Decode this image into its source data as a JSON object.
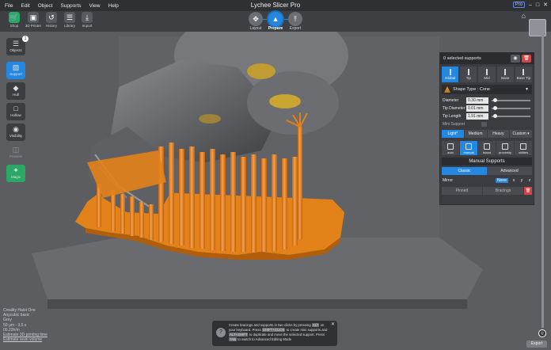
{
  "menu": [
    "File",
    "Edit",
    "Object",
    "Supports",
    "View",
    "Help"
  ],
  "app_title": "Lychee Slicer Pro",
  "pro_badge": "Pro",
  "toolbar": {
    "tools": [
      {
        "label": "Shop",
        "icon": "cart-icon"
      },
      {
        "label": "3D Printer",
        "icon": "printer-icon"
      },
      {
        "label": "History",
        "icon": "history-icon"
      },
      {
        "label": "Library",
        "icon": "library-icon"
      },
      {
        "label": "Import",
        "icon": "import-icon"
      }
    ],
    "modes": [
      {
        "label": "Layout",
        "icon": "move-icon"
      },
      {
        "label": "Prepare",
        "icon": "support-icon",
        "active": true
      },
      {
        "label": "Export",
        "icon": "export-icon"
      }
    ]
  },
  "left_tools": [
    {
      "label": "Objects",
      "badge": "1"
    },
    {
      "label": "Support",
      "active": true
    },
    {
      "label": "Hull"
    },
    {
      "label": "Hollow"
    },
    {
      "label": "Visibility"
    },
    {
      "label": "Preview"
    },
    {
      "label": "Magic"
    }
  ],
  "panel": {
    "header": "0 selected supports",
    "tips": [
      "Global",
      "Tip",
      "Mid",
      "Base",
      "Base Tip"
    ],
    "shape_type": "Shape Type : Cone",
    "params": [
      {
        "label": "Diameter",
        "value": "0.30 mm"
      },
      {
        "label": "Tip Diameter",
        "value": "0.01 mm"
      },
      {
        "label": "Tip Length",
        "value": "1.91 mm"
      }
    ],
    "mini_support": "Mini Support",
    "densities": [
      "Light*",
      "Medium",
      "Heavy",
      "Custom ▾"
    ],
    "support_modes": [
      "auto",
      "manual",
      "island",
      "proximity",
      "utilities"
    ],
    "manual_title": "Manual Supports",
    "classic": "Classic",
    "advanced": "Advanced",
    "mirror_label": "Mirror",
    "mirror_options": [
      "None",
      "x",
      "y",
      "z"
    ],
    "footer": [
      "Pinned",
      "Bracings"
    ]
  },
  "info_lines": [
    "Creality Halot One",
    "Anycubic basic",
    "Grey",
    "50 µm - 3.5 s",
    "00.23h/m",
    "Estimate 3D printing time",
    "Estimate resin volume"
  ],
  "tip_bar": {
    "text1": "Create bracings and supports in two clicks by pressing",
    "key1": "ALT",
    "text2": "on your keyboard. Press",
    "key2": "SHIFT+CLICK",
    "text3": "to create mini supports",
    "text4": "and",
    "key3": "ALT+SHIFT",
    "text5": "to duplicate and move the selected support.",
    "text6": "Press",
    "key4": "TAB",
    "text7": "to switch to Advanced Editing Mode"
  },
  "export_label": "Export",
  "colors": {
    "accent": "#2588e0",
    "support": "#f08a1c",
    "model": "#6a6c70"
  }
}
